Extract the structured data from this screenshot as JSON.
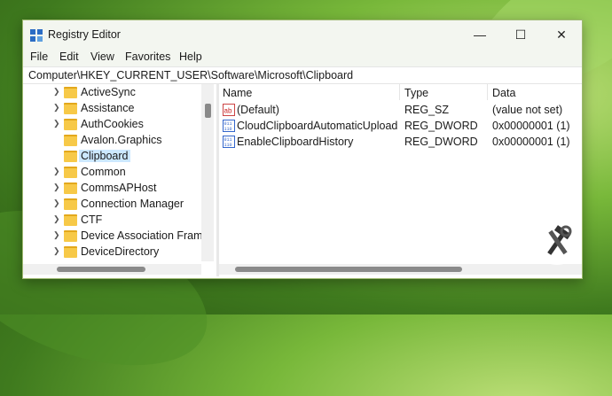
{
  "window": {
    "title": "Registry Editor",
    "controls": {
      "minimize": "—",
      "maximize": "☐",
      "close": "✕"
    }
  },
  "menu": [
    "File",
    "Edit",
    "View",
    "Favorites",
    "Help"
  ],
  "address": "Computer\\HKEY_CURRENT_USER\\Software\\Microsoft\\Clipboard",
  "tree": {
    "items": [
      {
        "label": "ActiveSync",
        "expandable": true
      },
      {
        "label": "Assistance",
        "expandable": true
      },
      {
        "label": "AuthCookies",
        "expandable": true
      },
      {
        "label": "Avalon.Graphics",
        "expandable": false
      },
      {
        "label": "Clipboard",
        "expandable": false,
        "selected": true
      },
      {
        "label": "Common",
        "expandable": true
      },
      {
        "label": "CommsAPHost",
        "expandable": true
      },
      {
        "label": "Connection Manager",
        "expandable": true
      },
      {
        "label": "CTF",
        "expandable": true
      },
      {
        "label": "Device Association Frame",
        "expandable": true
      },
      {
        "label": "DeviceDirectory",
        "expandable": true
      }
    ]
  },
  "values_pane": {
    "columns": {
      "name": "Name",
      "type": "Type",
      "data": "Data"
    },
    "rows": [
      {
        "icon": "string-value-icon",
        "name": "(Default)",
        "type": "REG_SZ",
        "data": "(value not set)"
      },
      {
        "icon": "dword-value-icon",
        "name": "CloudClipboardAutomaticUpload",
        "type": "REG_DWORD",
        "data": "0x00000001 (1)"
      },
      {
        "icon": "dword-value-icon",
        "name": "EnableClipboardHistory",
        "type": "REG_DWORD",
        "data": "0x00000001 (1)"
      }
    ]
  },
  "colors": {
    "selection": "#cce8ff",
    "folder": "#f7c948",
    "titlebar": "#f3f6f0"
  }
}
